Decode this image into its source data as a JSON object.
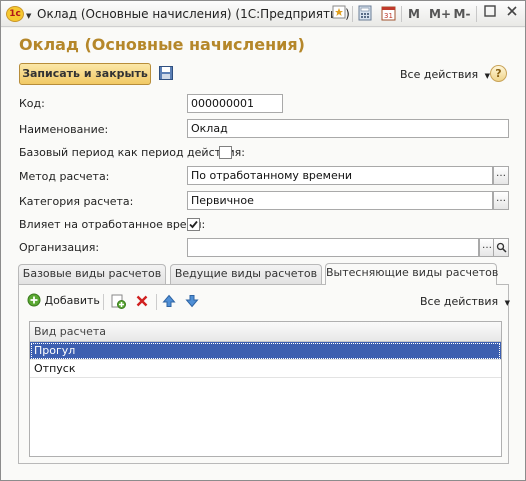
{
  "window": {
    "title": "Оклад (Основные начисления)  (1С:Предприятие)",
    "logo_text": "1с",
    "controls": {
      "m": "M",
      "m_plus": "M+",
      "m_minus": "M-"
    }
  },
  "form": {
    "title": "Оклад (Основные начисления)",
    "save_close_label": "Записать и закрыть",
    "all_actions_label": "Все действия",
    "help_label": "?"
  },
  "fields": {
    "code": {
      "label": "Код:",
      "value": "000000001"
    },
    "name": {
      "label": "Наименование:",
      "value": "Оклад"
    },
    "base_period": {
      "label": "Базовый период как период действия:",
      "checked": false
    },
    "calc_method": {
      "label": "Метод расчета:",
      "value": "По отработанному времени"
    },
    "calc_category": {
      "label": "Категория расчета:",
      "value": "Первичное"
    },
    "affects_time": {
      "label": "Влияет на отработанное время:",
      "checked": true
    },
    "organization": {
      "label": "Организация:",
      "value": ""
    }
  },
  "tabs": [
    {
      "label": "Базовые виды расчетов",
      "active": false
    },
    {
      "label": "Ведущие виды расчетов",
      "active": false
    },
    {
      "label": "Вытесняющие виды расчетов",
      "active": true
    }
  ],
  "panel": {
    "add_label": "Добавить",
    "all_actions_label": "Все действия",
    "table": {
      "header": "Вид расчета",
      "rows": [
        {
          "value": "Прогул",
          "selected": true
        },
        {
          "value": "Отпуск",
          "selected": false
        }
      ]
    }
  },
  "colors": {
    "title_accent": "#b5872a",
    "selection": "#3d5fb0",
    "primary_button": "#f1c964"
  }
}
